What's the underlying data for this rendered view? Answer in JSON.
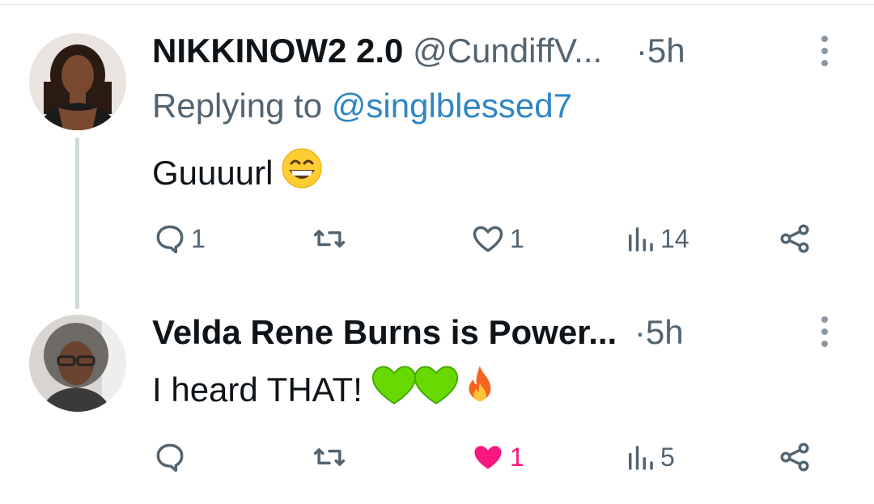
{
  "colors": {
    "text": "#0f1419",
    "secondary": "#536471",
    "link": "#2f86c4",
    "like": "#f91880",
    "thread_line": "#cfd9de"
  },
  "tweets": [
    {
      "display_name": "NIKKINOW2 2.0",
      "handle": "@CundiffV...",
      "separator": "·",
      "time": "5h",
      "replying_prefix": "Replying to ",
      "replying_to": "@singlblessed7",
      "text": "Guuuurl",
      "emojis": [
        "grinning-face-with-smiling-eyes"
      ],
      "actions": {
        "reply_count": "1",
        "retweet_count": "",
        "like_count": "1",
        "liked": false,
        "views_count": "14"
      }
    },
    {
      "display_name": "Velda Rene Burns is Power...",
      "separator": "·",
      "time": "5h",
      "text": "I heard THAT!",
      "emojis": [
        "green-heart",
        "green-heart",
        "fire"
      ],
      "actions": {
        "reply_count": "",
        "retweet_count": "",
        "like_count": "1",
        "liked": true,
        "views_count": "5"
      }
    }
  ]
}
